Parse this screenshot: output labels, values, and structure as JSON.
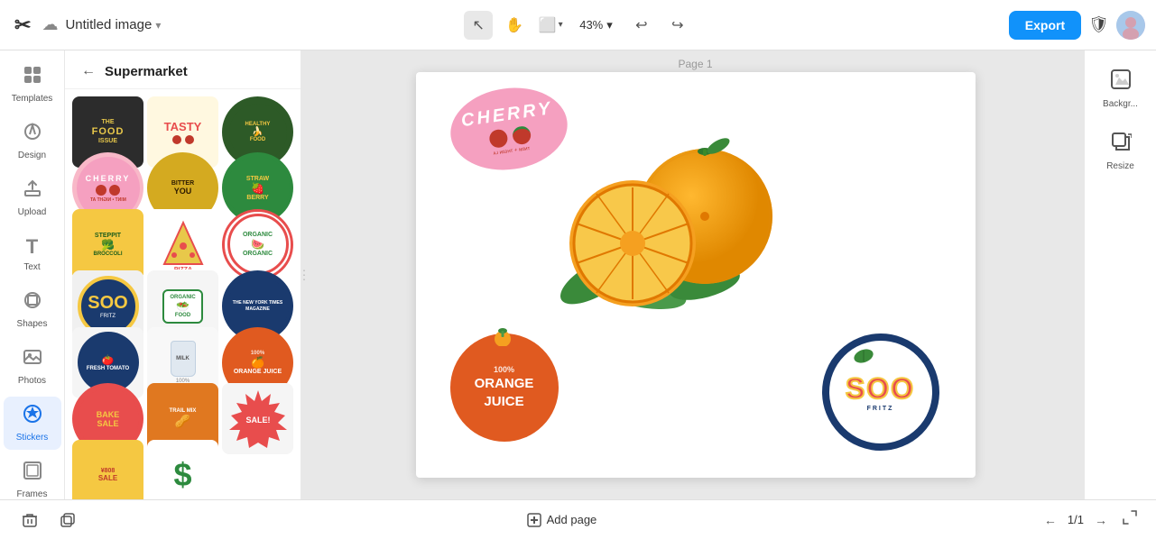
{
  "app": {
    "logo": "✂",
    "title": "Supermarket",
    "back_label": "←"
  },
  "topbar": {
    "cloud_icon": "☁",
    "doc_title": "Untitled image",
    "chevron": "▾",
    "tool_select": "↖",
    "tool_hand": "✋",
    "tool_frame": "⬜",
    "zoom_level": "43%",
    "zoom_chevron": "▾",
    "undo": "↩",
    "redo": "↪",
    "export_label": "Export",
    "shield_icon": "🛡"
  },
  "nav": {
    "items": [
      {
        "id": "templates",
        "icon": "⊞",
        "label": "Templates"
      },
      {
        "id": "design",
        "icon": "✏",
        "label": "Design"
      },
      {
        "id": "upload",
        "icon": "↑",
        "label": "Upload"
      },
      {
        "id": "text",
        "icon": "T",
        "label": "Text"
      },
      {
        "id": "shapes",
        "icon": "◎",
        "label": "Shapes"
      },
      {
        "id": "photos",
        "icon": "🖼",
        "label": "Photos"
      },
      {
        "id": "stickers",
        "icon": "★",
        "label": "Stickers",
        "active": true
      },
      {
        "id": "frames",
        "icon": "⬜",
        "label": "Frames"
      }
    ]
  },
  "sticker_panel": {
    "back": "←",
    "title": "Supermarket",
    "stickers": [
      {
        "id": "food-issue",
        "label": "THE FOOD ISSUE",
        "class": "s-food-issue"
      },
      {
        "id": "tasty",
        "label": "TASTY",
        "class": "s-tasty"
      },
      {
        "id": "healthy-food",
        "label": "HEALTHY FOOD",
        "class": "s-healthy"
      },
      {
        "id": "cherry",
        "label": "CHERRY",
        "class": "s-cherry"
      },
      {
        "id": "bitter-you",
        "label": "BITTER YOU",
        "class": "s-bitter"
      },
      {
        "id": "strawberry",
        "label": "STRAWBERRY",
        "class": "s-strawberry"
      },
      {
        "id": "steppit-broc",
        "label": "STEPPIT",
        "class": "s-steppit"
      },
      {
        "id": "pizza",
        "label": "PIZZA",
        "class": "s-pizza"
      },
      {
        "id": "organic",
        "label": "ORGANIC",
        "class": "s-organic"
      },
      {
        "id": "soo-blue",
        "label": "SOO",
        "class": "s-soo-blue"
      },
      {
        "id": "organic-food",
        "label": "ORGANIC FOOD",
        "class": "s-organic-food"
      },
      {
        "id": "nyt",
        "label": "NEW YORK TIMES",
        "class": "s-nyt"
      },
      {
        "id": "fresh-tomato",
        "label": "FRESH TOMATO",
        "class": "s-fresh-tomato"
      },
      {
        "id": "milk",
        "label": "MILK",
        "class": "s-milk"
      },
      {
        "id": "orange-juice",
        "label": "100% ORANGE JUICE",
        "class": "s-orange-juice"
      },
      {
        "id": "bake-sale",
        "label": "BAKE SALE",
        "class": "s-bake-sale"
      },
      {
        "id": "trail-mix",
        "label": "TRAIL MIX",
        "class": "s-trail-mix"
      },
      {
        "id": "sale-burst",
        "label": "SALE",
        "class": "s-sale-burst"
      },
      {
        "id": "price-tag",
        "label": "¥808 SALE",
        "class": "s-price-tag"
      },
      {
        "id": "dollar",
        "label": "$",
        "class": "s-dollar"
      }
    ]
  },
  "canvas": {
    "page_label": "Page 1",
    "cherry_text": "CHERRY",
    "cherry_sub": "ᴛɴɪᴍ + ᴛʜɢɪɴ ʟᴀ",
    "orange_juice_top": "100%",
    "orange_juice_mid": "ORANGE",
    "orange_juice_bot": "JUICE",
    "soo_text": "SOO",
    "soo_sub": "FRITZ"
  },
  "right_panel": {
    "bg_icon": "⬜",
    "bg_label": "Backgr...",
    "resize_icon": "⤡",
    "resize_label": "Resize"
  },
  "bottom": {
    "trash_icon": "🗑",
    "delete_icon": "⬜",
    "add_page_icon": "+",
    "add_page_label": "Add page",
    "prev_icon": "←",
    "page_counter": "1/1",
    "next_icon": "→",
    "expand_icon": "⤡"
  }
}
